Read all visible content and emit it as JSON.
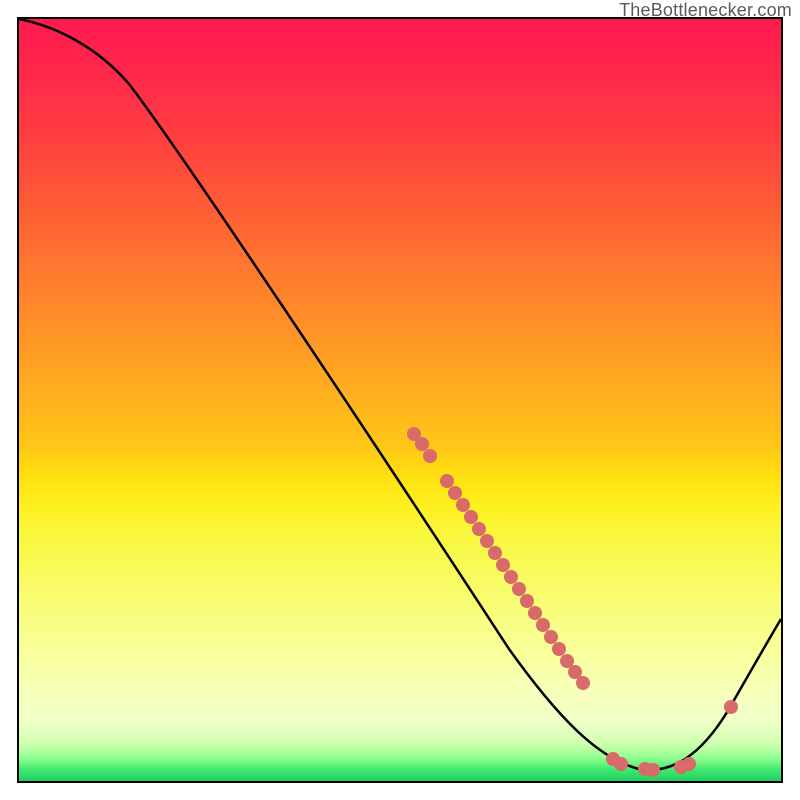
{
  "attribution": "TheBottlenecker.com",
  "chart_data": {
    "type": "line",
    "title": "",
    "xlabel": "",
    "ylabel": "",
    "xlim": [
      0,
      100
    ],
    "ylim": [
      0,
      100
    ],
    "series": [
      {
        "name": "bottleneck-curve",
        "x": [
          0,
          4,
          8,
          12,
          16,
          20,
          24,
          28,
          32,
          36,
          40,
          44,
          48,
          52,
          56,
          60,
          64,
          68,
          72,
          76,
          80,
          84,
          88,
          92,
          96,
          100
        ],
        "y": [
          100,
          100,
          98,
          94,
          88,
          81,
          74,
          67,
          60,
          54,
          48,
          42,
          36,
          30,
          24,
          19,
          14,
          9,
          5,
          2,
          0.5,
          0.5,
          2,
          6,
          12,
          20
        ]
      }
    ],
    "highlight_points": {
      "name": "markers",
      "x": [
        50,
        51,
        52,
        54,
        55,
        56,
        57,
        58,
        59,
        60,
        61,
        62,
        63,
        64,
        65,
        66,
        67,
        68,
        69,
        70,
        71,
        75,
        77,
        78,
        81,
        82,
        83,
        86,
        92
      ],
      "y": [
        42,
        41,
        40,
        37,
        36,
        34.5,
        33,
        32,
        30.5,
        29,
        27.5,
        26,
        25,
        23.5,
        22,
        20.5,
        19,
        17.5,
        16,
        15,
        14,
        2,
        1,
        1,
        0.5,
        0.5,
        0.5,
        2,
        8
      ]
    },
    "background_gradient": {
      "top": "#ff1a4f",
      "mid": "#ffe010",
      "bottom": "#20d060"
    }
  }
}
